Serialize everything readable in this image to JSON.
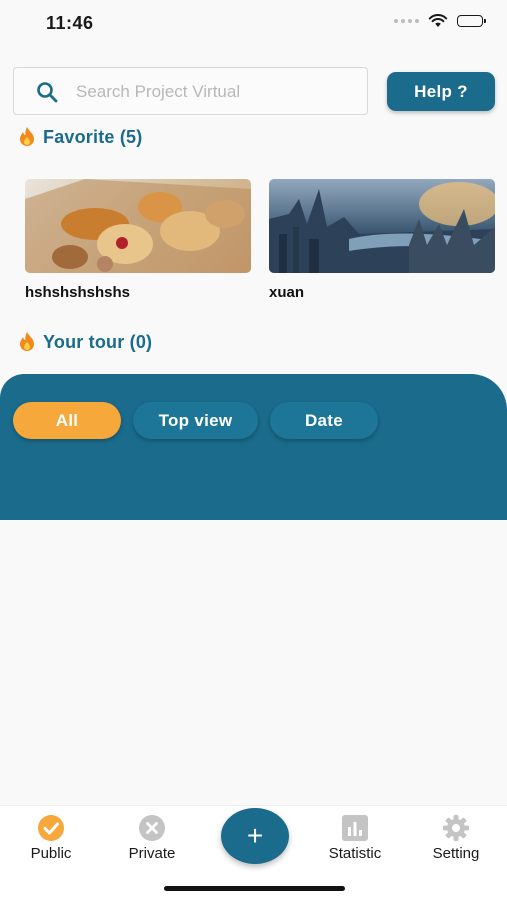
{
  "status": {
    "time": "11:46"
  },
  "search": {
    "placeholder": "Search Project Virtual",
    "value": ""
  },
  "help_button": {
    "label": "Help ?"
  },
  "favorite": {
    "title": "Favorite (5)",
    "items": [
      {
        "name": "hshshshshshs",
        "image": "pastry-photo"
      },
      {
        "name": "xuan",
        "image": "city-photo"
      }
    ]
  },
  "tour": {
    "title": "Your tour (0)"
  },
  "filters": [
    {
      "label": "All",
      "active": true
    },
    {
      "label": "Top view",
      "active": false
    },
    {
      "label": "Date",
      "active": false
    }
  ],
  "tabs": [
    {
      "label": "Public",
      "icon": "check-circle-icon",
      "active": true
    },
    {
      "label": "Private",
      "icon": "x-circle-icon",
      "active": false
    },
    {
      "label": "+",
      "icon": "plus-icon"
    },
    {
      "label": "Statistic",
      "icon": "bar-chart-icon",
      "active": false
    },
    {
      "label": "Setting",
      "icon": "gear-icon",
      "active": false
    }
  ],
  "colors": {
    "primary": "#1b6b8c",
    "accent": "#f7a83a",
    "flame": "#f08a1c",
    "inactive_icon": "#c4c4c4"
  }
}
